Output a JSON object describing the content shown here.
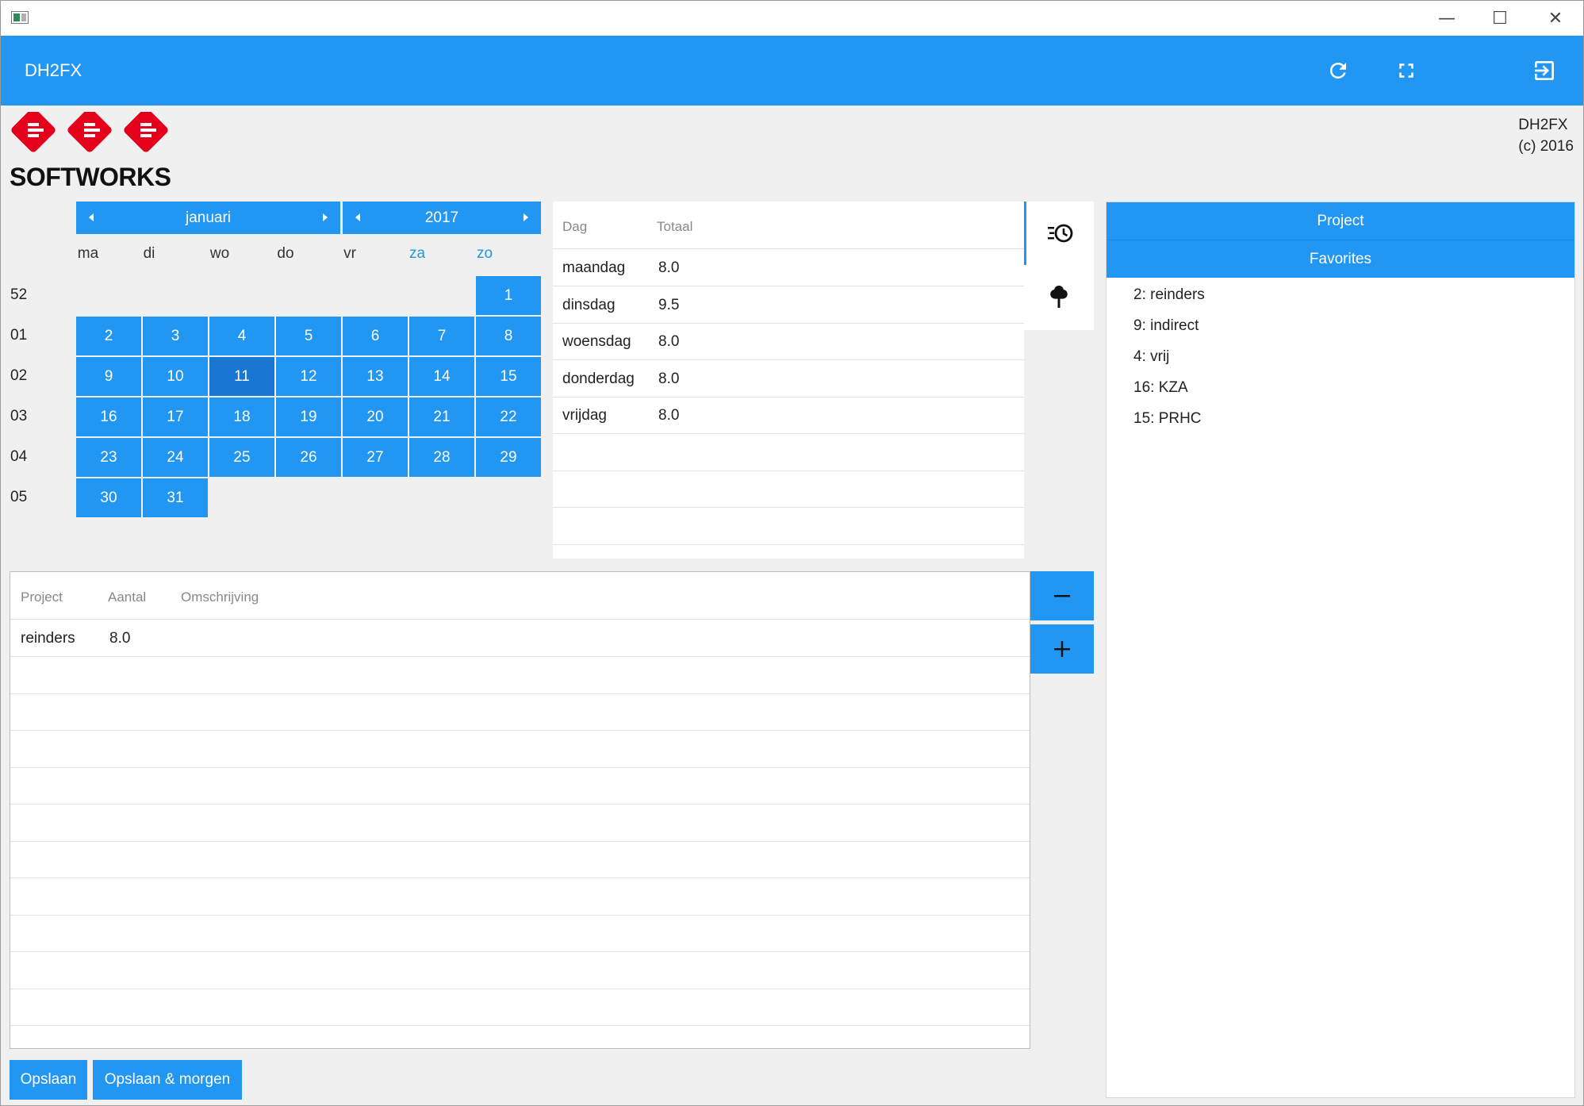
{
  "app": {
    "title": "DH2FX",
    "copyright_line1": "DH2FX",
    "copyright_line2": "(c) 2016",
    "logo_text": "SOFTWORKS"
  },
  "window_controls": {
    "minimize": "—",
    "maximize": "☐",
    "close": "✕"
  },
  "toolbar_icons": [
    "refresh-icon",
    "fullscreen-icon",
    "exit-icon"
  ],
  "calendar": {
    "month": "januari",
    "year": "2017",
    "weekdays": [
      "ma",
      "di",
      "wo",
      "do",
      "vr",
      "za",
      "zo"
    ],
    "week_numbers": [
      "52",
      "01",
      "02",
      "03",
      "04",
      "05"
    ],
    "days": [
      "1",
      "2",
      "3",
      "4",
      "5",
      "6",
      "7",
      "8",
      "9",
      "10",
      "11",
      "12",
      "13",
      "14",
      "15",
      "16",
      "17",
      "18",
      "19",
      "20",
      "21",
      "22",
      "23",
      "24",
      "25",
      "26",
      "27",
      "28",
      "29",
      "30",
      "31"
    ],
    "selected_day": "11"
  },
  "day_totals": {
    "headers": [
      "Dag",
      "Totaal"
    ],
    "rows": [
      [
        "maandag",
        "8.0"
      ],
      [
        "dinsdag",
        "9.5"
      ],
      [
        "woensdag",
        "8.0"
      ],
      [
        "donderdag",
        "8.0"
      ],
      [
        "vrijdag",
        "8.0"
      ]
    ]
  },
  "tool_strip_icons": [
    "history-icon",
    "tree-icon"
  ],
  "right_panel": {
    "project_header": "Project",
    "favorites_header": "Favorites",
    "favorites": [
      "2: reinders",
      "9: indirect",
      "4: vrij",
      "16: KZA",
      "15: PRHC"
    ]
  },
  "entries": {
    "headers": [
      "Project",
      "Aantal",
      "Omschrijving"
    ],
    "rows": [
      [
        "reinders",
        "8.0",
        ""
      ]
    ]
  },
  "buttons": {
    "remove_icon": "minus-icon",
    "add_icon": "plus-icon",
    "save": "Opslaan",
    "save_tomorrow": "Opslaan & morgen"
  }
}
